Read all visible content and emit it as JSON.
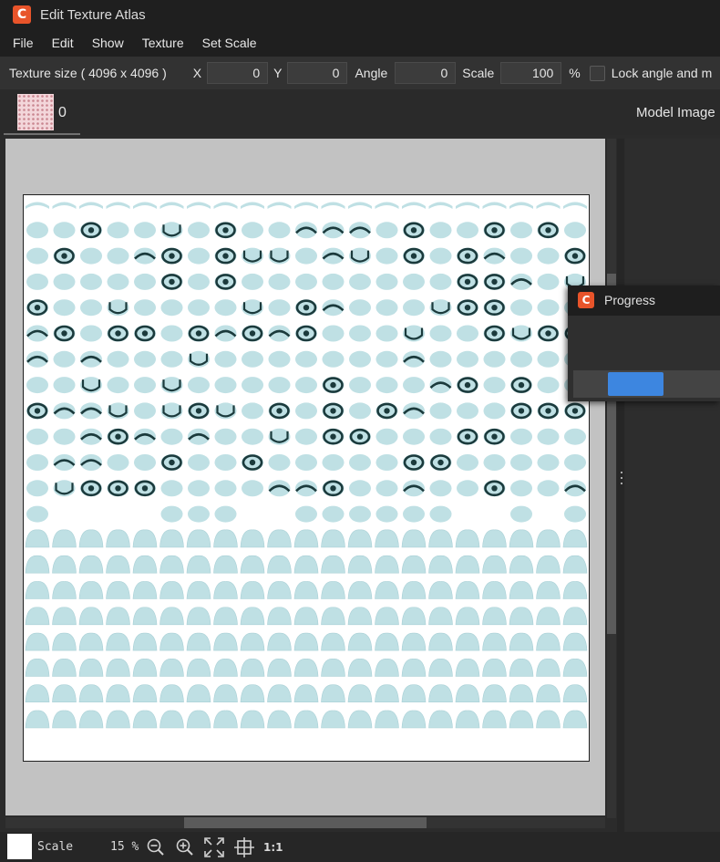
{
  "window": {
    "title": "Edit Texture Atlas",
    "logo_icon": "app-logo-icon"
  },
  "menu": [
    "File",
    "Edit",
    "Show",
    "Texture",
    "Set Scale"
  ],
  "toolbar": {
    "texture_size": "Texture size ( 4096 x 4096 )",
    "x_label": "X",
    "x_value": "0",
    "y_label": "Y",
    "y_value": "0",
    "angle_label": "Angle",
    "angle_value": "0",
    "scale_label": "Scale",
    "scale_value": "100",
    "percent": "%",
    "lock_label": "Lock angle and m",
    "lock_checked": false
  },
  "texture_tab": {
    "index": "0"
  },
  "right_panel": {
    "title": "Model Image"
  },
  "atlas_view": {
    "background": "#ffffff",
    "part_fill": "#bfe0e4",
    "ink": "#1b3a3c"
  },
  "bottom_bar": {
    "scale_label": "Scale",
    "zoom_value": "15 %",
    "one_to_one": "1:1",
    "icons": [
      "zoom-out-icon",
      "zoom-in-icon",
      "fit-to-view-icon",
      "crosshair-icon"
    ]
  },
  "progress": {
    "title": "Progress",
    "fraction": 0.38,
    "bar_color": "#3d86e0"
  }
}
